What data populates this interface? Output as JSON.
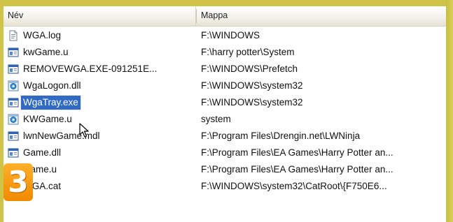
{
  "columns": {
    "name": "Név",
    "folder": "Mappa"
  },
  "rows": [
    {
      "name": "WGA.log",
      "folder": "F:\\WINDOWS",
      "icon": "text-file-icon",
      "selected": false
    },
    {
      "name": "kwGame.u",
      "folder": "F:\\harry potter\\System",
      "icon": "app-window-icon",
      "selected": false
    },
    {
      "name": "REMOVEWGA.EXE-091251E...",
      "folder": "F:\\WINDOWS\\Prefetch",
      "icon": "app-window-icon",
      "selected": false
    },
    {
      "name": "WgaLogon.dll",
      "folder": "F:\\WINDOWS\\system32",
      "icon": "dll-gear-icon",
      "selected": false
    },
    {
      "name": "WgaTray.exe",
      "folder": "F:\\WINDOWS\\system32",
      "icon": "app-window-icon",
      "selected": true
    },
    {
      "name": "KWGame.u",
      "folder": "system",
      "icon": "dll-gear-icon",
      "selected": false
    },
    {
      "name": "lwnNewGame.mdl",
      "folder": "F:\\Program Files\\Drengin.net\\LWNinja",
      "icon": "app-window-icon",
      "selected": false
    },
    {
      "name": "Game.dll",
      "folder": "F:\\Program Files\\EA Games\\Harry Potter an...",
      "icon": "app-window-icon",
      "selected": false
    },
    {
      "name": "Game.u",
      "folder": "F:\\Program Files\\EA Games\\Harry Potter an...",
      "icon": "app-window-icon",
      "selected": false
    },
    {
      "name": "WGA.cat",
      "folder": "F:\\WINDOWS\\system32\\CatRoot\\{F750E6...",
      "icon": "catalog-file-icon",
      "selected": false
    }
  ],
  "step_badge": "3",
  "colors": {
    "frame": "#cfc447",
    "selection": "#316ac5",
    "badge": "#f59300"
  }
}
